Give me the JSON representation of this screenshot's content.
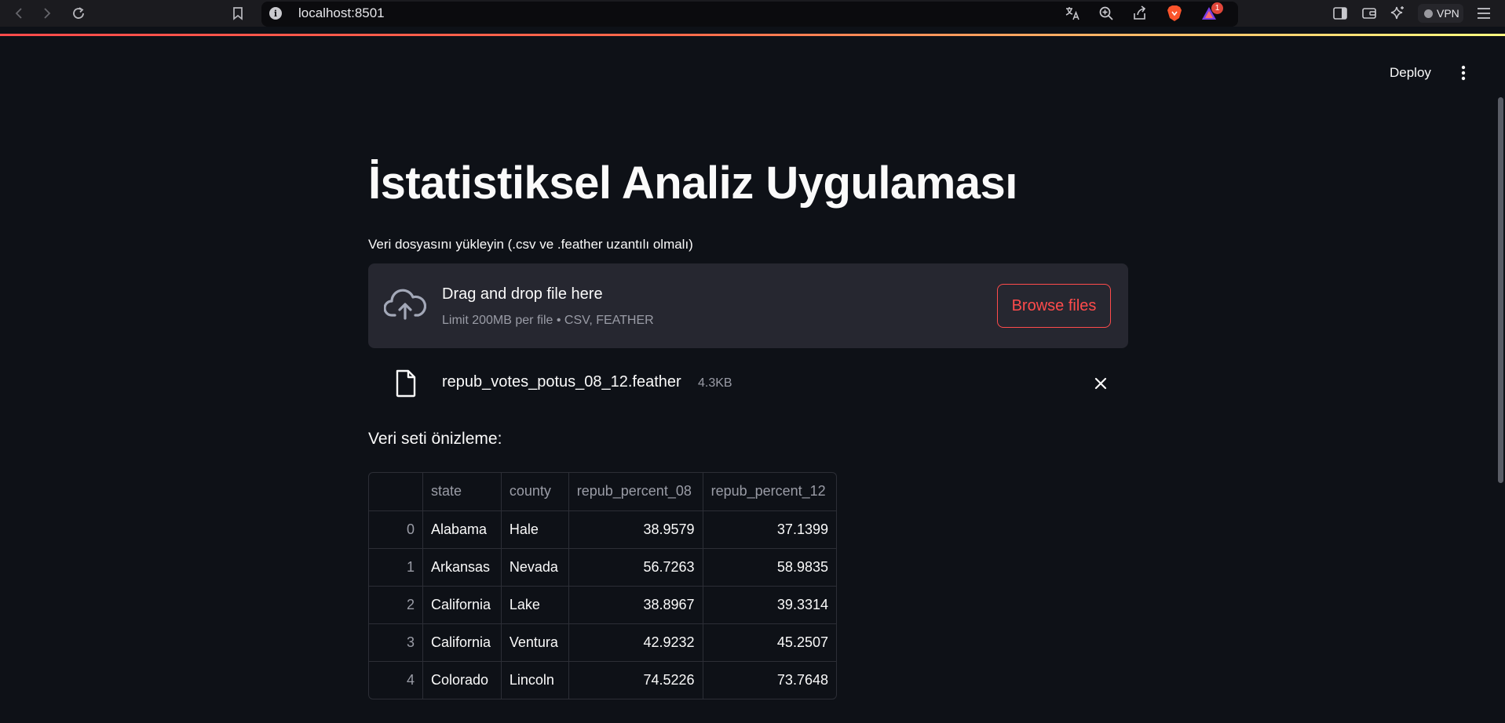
{
  "browser": {
    "url": "localhost:8501",
    "notification_count": "1",
    "vpn_label": "VPN"
  },
  "header": {
    "deploy_label": "Deploy"
  },
  "main": {
    "title": "İstatistiksel Analiz Uygulaması",
    "uploader": {
      "label": "Veri dosyasını yükleyin (.csv ve .feather uzantılı olmalı)",
      "drop_text": "Drag and drop file here",
      "limit_text": "Limit 200MB per file • CSV, FEATHER",
      "browse_label": "Browse files"
    },
    "uploaded_file": {
      "name": "repub_votes_potus_08_12.feather",
      "size": "4.3KB"
    },
    "preview_label": "Veri seti önizleme:",
    "table": {
      "columns": [
        "",
        "state",
        "county",
        "repub_percent_08",
        "repub_percent_12"
      ],
      "rows": [
        {
          "index": "0",
          "state": "Alabama",
          "county": "Hale",
          "p08": "38.9579",
          "p12": "37.1399"
        },
        {
          "index": "1",
          "state": "Arkansas",
          "county": "Nevada",
          "p08": "56.7263",
          "p12": "58.9835"
        },
        {
          "index": "2",
          "state": "California",
          "county": "Lake",
          "p08": "38.8967",
          "p12": "39.3314"
        },
        {
          "index": "3",
          "state": "California",
          "county": "Ventura",
          "p08": "42.9232",
          "p12": "45.2507"
        },
        {
          "index": "4",
          "state": "Colorado",
          "county": "Lincoln",
          "p08": "74.5226",
          "p12": "73.7648"
        }
      ]
    }
  },
  "colors": {
    "background": "#0e1117",
    "dropzone": "#262730",
    "accent": "#ff4b4b",
    "muted_text": "#9a9ca6"
  }
}
